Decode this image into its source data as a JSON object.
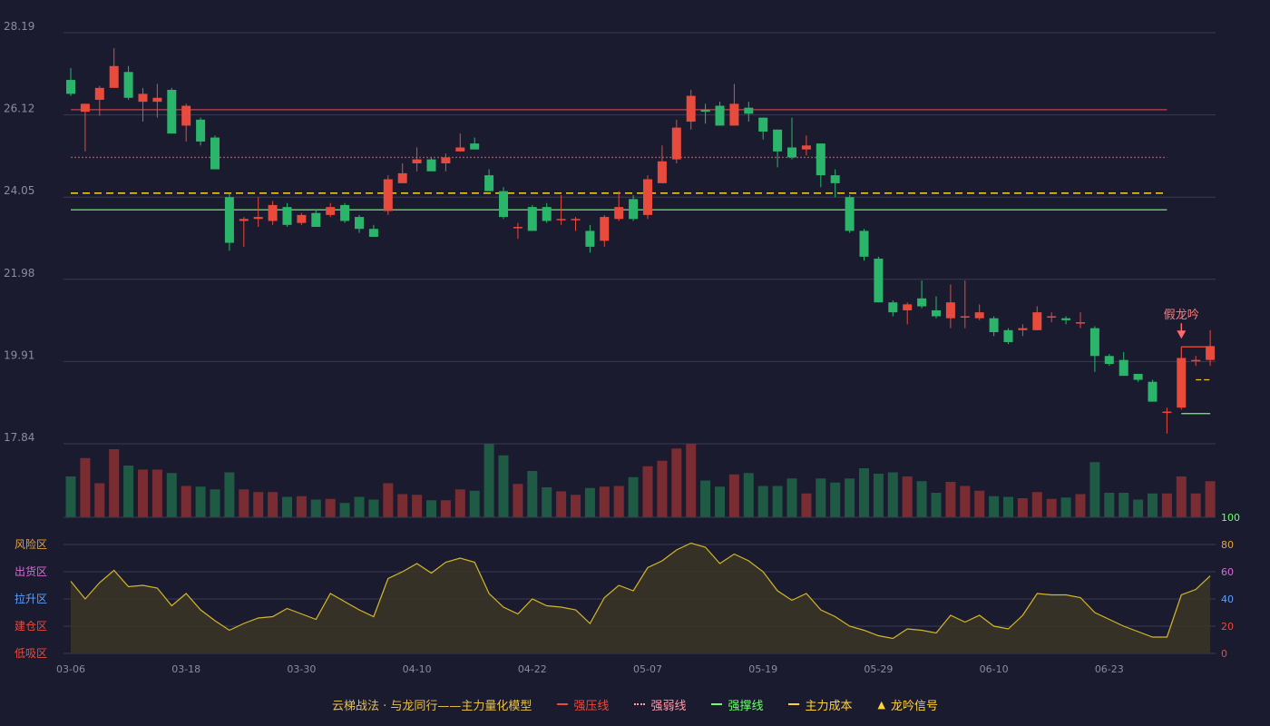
{
  "colors": {
    "background": "#1b1b2f",
    "up": "#e84a3c",
    "down": "#2bb56b",
    "volume_up": "#7a2c33",
    "volume_down": "#1f5a45",
    "grid": "#3a3a52",
    "axis_text": "#8c8ca0",
    "pressure": "#c0444a",
    "weak": "#c0444a",
    "support": "#6bd66b",
    "cost": "#e8c22a",
    "osc_line": "#d4b62a",
    "osc_fill": "#3a3526"
  },
  "legend": {
    "title": "云梯战法 · 与龙同行——主力量化模型",
    "items": [
      {
        "label": "强压线",
        "style": "solid",
        "color": "#e84a3c"
      },
      {
        "label": "强弱线",
        "style": "dotted",
        "color": "#ff9aa8"
      },
      {
        "label": "强撑线",
        "style": "solid",
        "color": "#6bff6b"
      },
      {
        "label": "主力成本",
        "style": "dashed",
        "color": "#ffd23a"
      },
      {
        "label": "龙吟信号",
        "style": "triangle",
        "color": "#ffd23a"
      }
    ]
  },
  "chart_data": {
    "type": "candlestick",
    "y_ticks": [
      28.19,
      26.12,
      24.05,
      21.98,
      19.91,
      17.84
    ],
    "ylim": [
      17.84,
      28.19
    ],
    "x_tick_labels": [
      {
        "i": 0,
        "label": "03-06"
      },
      {
        "i": 8,
        "label": "03-18"
      },
      {
        "i": 16,
        "label": "03-30"
      },
      {
        "i": 24,
        "label": "04-10"
      },
      {
        "i": 32,
        "label": "04-22"
      },
      {
        "i": 40,
        "label": "05-07"
      },
      {
        "i": 48,
        "label": "05-19"
      },
      {
        "i": 56,
        "label": "05-29"
      },
      {
        "i": 64,
        "label": "06-10"
      },
      {
        "i": 72,
        "label": "06-23"
      }
    ],
    "candles": [
      [
        27.0,
        26.65,
        27.3,
        26.6
      ],
      [
        26.2,
        26.4,
        26.4,
        25.2
      ],
      [
        26.5,
        26.8,
        26.85,
        26.1
      ],
      [
        26.8,
        27.35,
        27.8,
        26.8
      ],
      [
        27.2,
        26.55,
        27.35,
        26.5
      ],
      [
        26.45,
        26.65,
        26.8,
        25.95
      ],
      [
        26.45,
        26.55,
        26.9,
        26.05
      ],
      [
        26.75,
        25.65,
        26.8,
        25.65
      ],
      [
        25.85,
        26.35,
        26.4,
        25.45
      ],
      [
        26.0,
        25.45,
        26.05,
        25.35
      ],
      [
        25.55,
        24.75,
        25.6,
        24.75
      ],
      [
        24.05,
        22.9,
        24.15,
        22.7
      ],
      [
        23.45,
        23.5,
        23.55,
        22.8
      ],
      [
        23.5,
        23.55,
        24.05,
        23.3
      ],
      [
        23.45,
        23.85,
        23.95,
        23.35
      ],
      [
        23.8,
        23.35,
        23.9,
        23.3
      ],
      [
        23.4,
        23.6,
        23.65,
        23.35
      ],
      [
        23.65,
        23.3,
        23.75,
        23.3
      ],
      [
        23.6,
        23.8,
        23.9,
        23.55
      ],
      [
        23.85,
        23.45,
        23.9,
        23.4
      ],
      [
        23.55,
        23.25,
        23.6,
        23.15
      ],
      [
        23.25,
        23.05,
        23.35,
        23.05
      ],
      [
        23.7,
        24.5,
        24.6,
        23.6
      ],
      [
        24.4,
        24.65,
        24.9,
        24.4
      ],
      [
        24.9,
        25.0,
        25.3,
        24.7
      ],
      [
        25.0,
        24.7,
        25.05,
        24.7
      ],
      [
        24.9,
        25.05,
        25.15,
        24.7
      ],
      [
        25.2,
        25.3,
        25.65,
        25.2
      ],
      [
        25.4,
        25.25,
        25.55,
        25.25
      ],
      [
        24.6,
        24.2,
        24.75,
        24.2
      ],
      [
        24.2,
        23.55,
        24.3,
        23.5
      ],
      [
        23.3,
        23.3,
        23.4,
        23.0
      ],
      [
        23.8,
        23.2,
        23.85,
        23.2
      ],
      [
        23.8,
        23.45,
        23.9,
        23.4
      ],
      [
        23.5,
        23.5,
        24.1,
        23.35
      ],
      [
        23.5,
        23.5,
        23.55,
        23.2
      ],
      [
        23.2,
        22.8,
        23.35,
        22.65
      ],
      [
        22.95,
        23.55,
        23.6,
        22.8
      ],
      [
        23.5,
        23.8,
        24.2,
        23.45
      ],
      [
        24.0,
        23.5,
        24.1,
        23.45
      ],
      [
        23.6,
        24.5,
        24.6,
        23.5
      ],
      [
        24.4,
        24.95,
        25.35,
        24.4
      ],
      [
        25.0,
        25.8,
        26.0,
        24.9
      ],
      [
        25.95,
        26.6,
        26.75,
        25.75
      ],
      [
        26.25,
        26.2,
        26.4,
        25.9
      ],
      [
        26.35,
        25.85,
        26.45,
        25.85
      ],
      [
        25.85,
        26.4,
        26.9,
        25.85
      ],
      [
        26.3,
        26.15,
        26.45,
        25.95
      ],
      [
        26.05,
        25.7,
        26.05,
        25.5
      ],
      [
        25.75,
        25.2,
        25.75,
        24.8
      ],
      [
        25.3,
        25.05,
        26.05,
        25.0
      ],
      [
        25.25,
        25.35,
        25.6,
        25.1
      ],
      [
        25.4,
        24.6,
        25.4,
        24.3
      ],
      [
        24.6,
        24.4,
        24.75,
        24.05
      ],
      [
        24.05,
        23.2,
        24.1,
        23.15
      ],
      [
        23.2,
        22.55,
        23.25,
        22.45
      ],
      [
        22.5,
        21.4,
        22.55,
        21.4
      ],
      [
        21.4,
        21.15,
        21.45,
        21.05
      ],
      [
        21.2,
        21.35,
        21.4,
        20.85
      ],
      [
        21.5,
        21.3,
        21.95,
        21.25
      ],
      [
        21.2,
        21.05,
        21.55,
        21.0
      ],
      [
        21.0,
        21.4,
        21.85,
        20.75
      ],
      [
        21.05,
        21.05,
        21.95,
        20.75
      ],
      [
        21.0,
        21.15,
        21.35,
        20.95
      ],
      [
        21.0,
        20.65,
        21.05,
        20.55
      ],
      [
        20.7,
        20.4,
        20.75,
        20.35
      ],
      [
        20.7,
        20.75,
        20.85,
        20.55
      ],
      [
        20.7,
        21.15,
        21.3,
        20.7
      ],
      [
        21.05,
        21.05,
        21.15,
        20.9
      ],
      [
        21.0,
        20.95,
        21.05,
        20.85
      ],
      [
        20.9,
        20.9,
        21.15,
        20.75
      ],
      [
        20.75,
        20.05,
        20.8,
        19.65
      ],
      [
        20.05,
        19.85,
        20.1,
        19.8
      ],
      [
        19.95,
        19.55,
        20.15,
        19.55
      ],
      [
        19.6,
        19.45,
        19.6,
        19.4
      ],
      [
        19.4,
        18.9,
        19.45,
        18.9
      ],
      [
        18.65,
        18.65,
        18.75,
        18.1
      ],
      [
        18.75,
        20.0,
        20.0,
        18.7
      ],
      [
        19.95,
        19.95,
        20.05,
        19.8
      ],
      [
        19.95,
        20.3,
        20.7,
        19.8
      ]
    ],
    "volumes": [
      0.6,
      0.87,
      0.5,
      1.0,
      0.76,
      0.7,
      0.7,
      0.65,
      0.46,
      0.45,
      0.41,
      0.66,
      0.41,
      0.37,
      0.37,
      0.3,
      0.31,
      0.26,
      0.27,
      0.21,
      0.3,
      0.26,
      0.5,
      0.34,
      0.33,
      0.25,
      0.25,
      0.41,
      0.39,
      1.08,
      0.91,
      0.49,
      0.68,
      0.44,
      0.38,
      0.33,
      0.43,
      0.45,
      0.46,
      0.59,
      0.75,
      0.83,
      1.01,
      1.08,
      0.54,
      0.45,
      0.63,
      0.65,
      0.46,
      0.46,
      0.57,
      0.35,
      0.57,
      0.51,
      0.57,
      0.72,
      0.64,
      0.66,
      0.6,
      0.53,
      0.36,
      0.52,
      0.46,
      0.39,
      0.31,
      0.3,
      0.28,
      0.37,
      0.27,
      0.29,
      0.34,
      0.81,
      0.36,
      0.36,
      0.26,
      0.35,
      0.35,
      0.6,
      0.35,
      0.53
    ],
    "lines": {
      "strong_pressure": {
        "value": 26.25,
        "from": 0,
        "to": 76
      },
      "strong_weak": {
        "value": 25.05,
        "from": 0,
        "to": 76
      },
      "main_cost": {
        "value": 24.15,
        "from": 0,
        "to": 76
      },
      "strong_support": {
        "value": 23.73,
        "from": 0,
        "to": 76
      },
      "post_pressure": {
        "value": 20.28,
        "from": 77,
        "to": 79
      },
      "post_cost": {
        "value": 19.45,
        "from": 78,
        "to": 79
      },
      "post_support": {
        "value": 18.6,
        "from": 77,
        "to": 79
      }
    },
    "signal": {
      "index": 77,
      "label": "假龙吟"
    },
    "oscillator": {
      "ylim": [
        0,
        100
      ],
      "y_ticks": [
        0,
        20,
        40,
        60,
        80,
        100
      ],
      "zones": [
        "风险区",
        "出货区",
        "拉升区",
        "建仓区",
        "低吸区"
      ],
      "values": [
        53,
        40,
        52,
        61,
        49,
        50,
        48,
        35,
        44,
        32,
        24,
        17,
        22,
        26,
        27,
        33,
        29,
        25,
        44,
        38,
        32,
        27,
        55,
        60,
        66,
        59,
        67,
        70,
        67,
        44,
        34,
        29,
        40,
        35,
        34,
        32,
        22,
        41,
        50,
        46,
        63,
        68,
        76,
        81,
        78,
        66,
        73,
        68,
        60,
        46,
        39,
        44,
        32,
        27,
        20,
        17,
        13,
        11,
        18,
        17,
        15,
        28,
        23,
        28,
        20,
        18,
        28,
        44,
        43,
        43,
        41,
        30,
        25,
        20,
        16,
        12,
        12,
        43,
        47,
        57
      ]
    }
  }
}
